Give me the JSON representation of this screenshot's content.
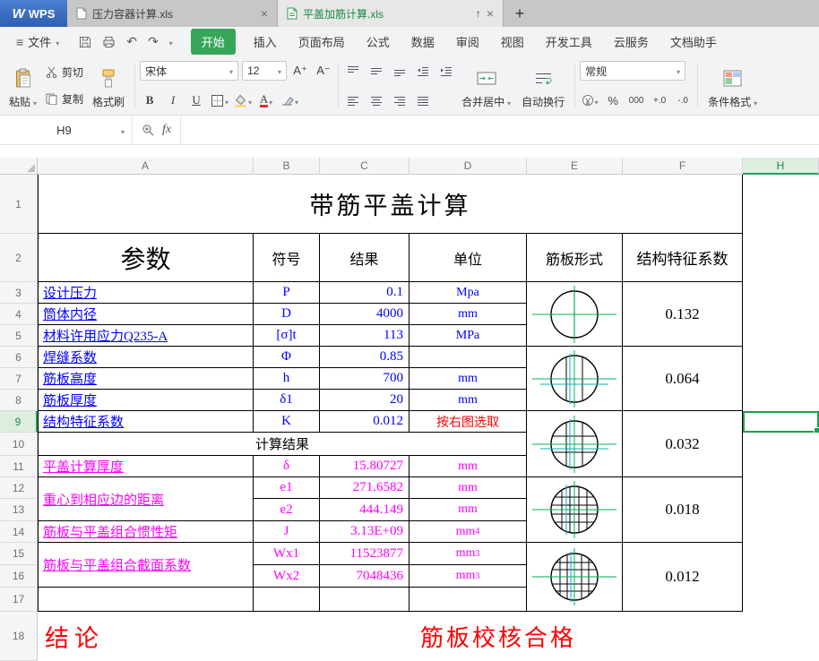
{
  "window": {
    "logo_text": "WPS",
    "tabs": [
      {
        "title": "压力容器计算.xls"
      },
      {
        "title": "平盖加筋计算.xls"
      }
    ]
  },
  "menu": {
    "file_label": "文件",
    "items": [
      "开始",
      "插入",
      "页面布局",
      "公式",
      "数据",
      "审阅",
      "视图",
      "开发工具",
      "云服务",
      "文档助手"
    ]
  },
  "toolbar": {
    "paste_label": "粘贴",
    "cut_label": "剪切",
    "copy_label": "复制",
    "format_painter_label": "格式刷",
    "font_name": "宋体",
    "font_size": "12",
    "font_grow_label": "A⁺",
    "font_shrink_label": "A⁻",
    "bold_label": "B",
    "italic_label": "I",
    "underline_label": "U",
    "font_color_label": "A",
    "merge_center_label": "合并居中",
    "wrap_label": "自动换行",
    "number_format": "常规",
    "percent_label": "%",
    "thousands_label": "000",
    "inc_decimal_label": "+.0",
    "dec_decimal_label": "-.0",
    "conditional_format_label": "条件格式"
  },
  "formula_bar": {
    "name_box": "H9",
    "fx_label": "fx",
    "formula_value": ""
  },
  "sheet": {
    "col_headers": [
      "A",
      "B",
      "C",
      "D",
      "E",
      "F",
      "H"
    ],
    "row_headers": [
      "1",
      "2",
      "3",
      "4",
      "5",
      "6",
      "7",
      "8",
      "9",
      "10",
      "11",
      "12",
      "13",
      "14",
      "15",
      "16",
      "17",
      "18"
    ],
    "title": "带筋平盖计算",
    "columns": {
      "param": "参数",
      "symbol": "符号",
      "result": "结果",
      "unit": "单位",
      "rib_form": "筋板形式",
      "coefficient": "结构特征系数"
    },
    "rows": {
      "r3": {
        "label": "设计压力",
        "symbol": "P",
        "result": "0.1",
        "unit": "Mpa"
      },
      "r4": {
        "label": "筒体内径",
        "symbol": "D",
        "result": "4000",
        "unit": "mm"
      },
      "r5": {
        "label": "材料许用应力Q235-A",
        "symbol": "[σ]t",
        "result": "113",
        "unit": "MPa"
      },
      "r6": {
        "label": "焊缝系数",
        "symbol": "Φ",
        "result": "0.85"
      },
      "r7": {
        "label": "筋板高度",
        "symbol": "h",
        "result": "700",
        "unit": "mm"
      },
      "r8": {
        "label": "筋板厚度",
        "symbol": "δ1",
        "result": "20",
        "unit": "mm"
      },
      "r9": {
        "label": "结构特征系数",
        "symbol": "K",
        "result": "0.012",
        "note": "按右图选取"
      },
      "r10": {
        "label": "计算结果"
      },
      "r11": {
        "label": "平盖计算厚度",
        "symbol": "δ",
        "result": "15.80727",
        "unit": "mm"
      },
      "r12": {
        "label": "重心到相应边的距离",
        "symbol": "e1",
        "result": "271.6582",
        "unit": "mm"
      },
      "r13": {
        "symbol": "e2",
        "result": "444.149",
        "unit": "mm"
      },
      "r14": {
        "label": "筋板与平盖组合惯性矩",
        "symbol": "J",
        "result": "3.13E+09",
        "unit_base": "mm",
        "unit_sup": "4"
      },
      "r15": {
        "label": "筋板与平盖组合截面系数",
        "symbol": "Wx1",
        "result": "11523877",
        "unit_base": "mm",
        "unit_sup": "3"
      },
      "r16": {
        "symbol": "Wx2",
        "result": "7048436",
        "unit_base": "mm",
        "unit_sup": "3"
      },
      "r18": {
        "label": "结论",
        "verdict": "筋板校核合格"
      }
    },
    "coefficients": [
      "0.132",
      "0.064",
      "0.032",
      "0.018",
      "0.012"
    ],
    "selection": {
      "cell": "H9",
      "selected_column": "H",
      "selected_row": "9"
    },
    "colors": {
      "accent_green": "#1f9e50",
      "data_blue": "#0000ff",
      "data_magenta": "#ff00ff",
      "alert_red": "#ff0000"
    }
  }
}
